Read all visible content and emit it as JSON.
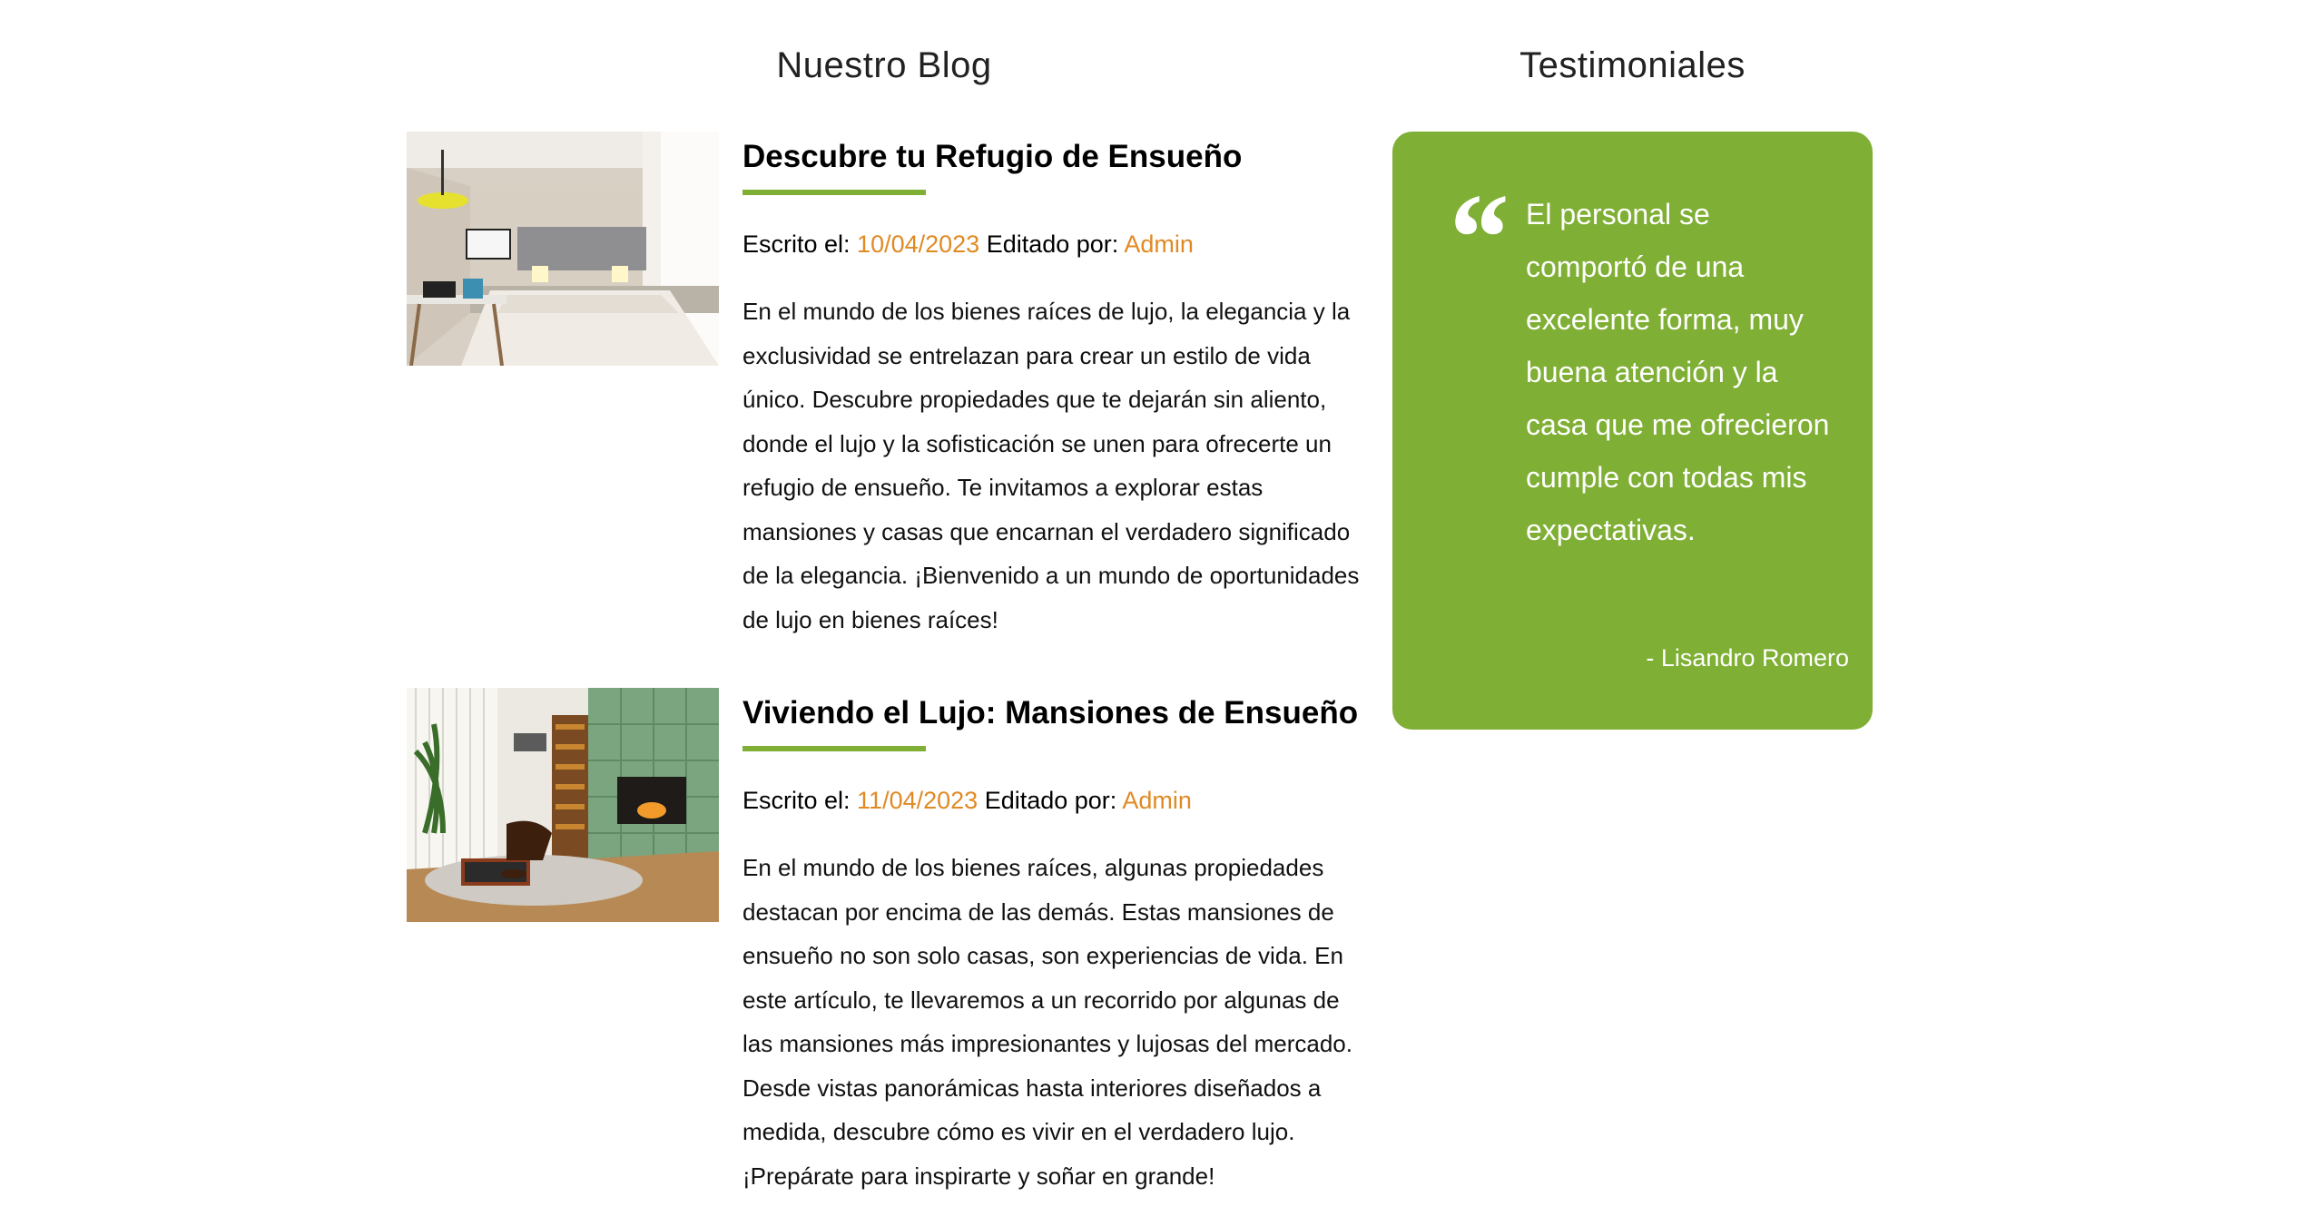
{
  "blog": {
    "title": "Nuestro Blog",
    "entries": [
      {
        "image_icon": "bedroom-photo",
        "title": "Descubre tu Refugio de Ensueño",
        "written_label": "Escrito el: ",
        "date": "10/04/2023",
        "edited_label": " Editado por: ",
        "author": "Admin",
        "text": "En el mundo de los bienes raíces de lujo, la elegancia y la exclusividad se entrelazan para crear un estilo de vida único. Descubre propiedades que te dejarán sin aliento, donde el lujo y la sofisticación se unen para ofrecerte un refugio de ensueño. Te invitamos a explorar estas mansiones y casas que encarnan el verdadero significado de la elegancia. ¡Bienvenido a un mundo de oportunidades de lujo en bienes raíces!"
      },
      {
        "image_icon": "living-room-photo",
        "title": "Viviendo el Lujo: Mansiones de Ensueño",
        "written_label": "Escrito el: ",
        "date": "11/04/2023",
        "edited_label": " Editado por: ",
        "author": "Admin",
        "text": "En el mundo de los bienes raíces, algunas propiedades destacan por encima de las demás. Estas mansiones de ensueño no son solo casas, son experiencias de vida. En este artículo, te llevaremos a un recorrido por algunas de las mansiones más impresionantes y lujosas del mercado. Desde vistas panorámicas hasta interiores diseñados a medida, descubre cómo es vivir en el verdadero lujo. ¡Prepárate para inspirarte y soñar en grande!"
      }
    ]
  },
  "testimonials": {
    "title": "Testimoniales",
    "quote_icon": "quote-icon",
    "quote": "El personal se comportó de una excelente forma, muy buena atención y la casa que me ofrecieron cumple con todas mis expectativas.",
    "author": "- Lisandro Romero"
  },
  "colors": {
    "accent_green": "#7faf34",
    "accent_orange": "#e08a24"
  }
}
